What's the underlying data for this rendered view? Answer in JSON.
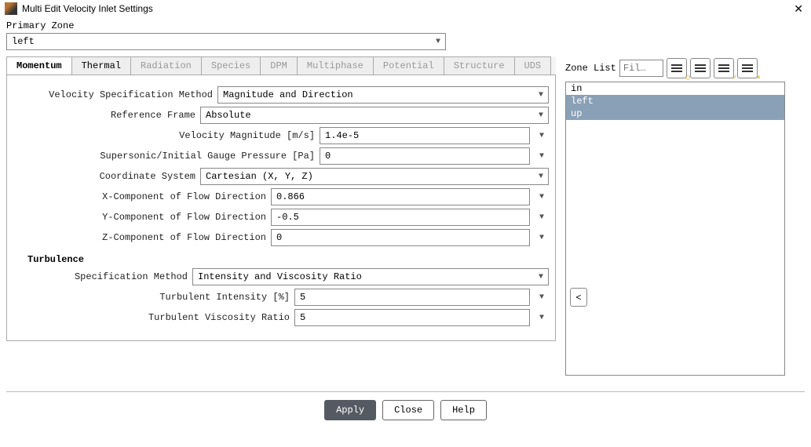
{
  "window": {
    "title": "Multi Edit Velocity Inlet Settings"
  },
  "primary_zone": {
    "label": "Primary Zone",
    "value": "left"
  },
  "tabs": [
    {
      "label": "Momentum",
      "active": true,
      "enabled": true
    },
    {
      "label": "Thermal",
      "active": false,
      "enabled": true
    },
    {
      "label": "Radiation",
      "active": false,
      "enabled": false
    },
    {
      "label": "Species",
      "active": false,
      "enabled": false
    },
    {
      "label": "DPM",
      "active": false,
      "enabled": false
    },
    {
      "label": "Multiphase",
      "active": false,
      "enabled": false
    },
    {
      "label": "Potential",
      "active": false,
      "enabled": false
    },
    {
      "label": "Structure",
      "active": false,
      "enabled": false
    },
    {
      "label": "UDS",
      "active": false,
      "enabled": false
    }
  ],
  "momentum": {
    "velocity_spec_method": {
      "label": "Velocity Specification Method",
      "value": "Magnitude and Direction"
    },
    "reference_frame": {
      "label": "Reference Frame",
      "value": "Absolute"
    },
    "velocity_magnitude": {
      "label": "Velocity Magnitude [m/s]",
      "value": "1.4e-5"
    },
    "supersonic_pressure": {
      "label": "Supersonic/Initial Gauge Pressure [Pa]",
      "value": "0"
    },
    "coord_system": {
      "label": "Coordinate System",
      "value": "Cartesian (X, Y, Z)"
    },
    "x_component": {
      "label": "X-Component of Flow Direction",
      "value": "0.866"
    },
    "y_component": {
      "label": "Y-Component of Flow Direction",
      "value": "-0.5"
    },
    "z_component": {
      "label": "Z-Component of Flow Direction",
      "value": "0"
    },
    "turbulence_header": "Turbulence",
    "turb_spec_method": {
      "label": "Specification Method",
      "value": "Intensity and Viscosity Ratio"
    },
    "turb_intensity": {
      "label": "Turbulent Intensity [%]",
      "value": "5"
    },
    "turb_viscosity_ratio": {
      "label": "Turbulent Viscosity Ratio",
      "value": "5"
    }
  },
  "zone_list": {
    "label": "Zone List",
    "filter_placeholder": "Fil…",
    "items": [
      {
        "name": "in",
        "selected": false
      },
      {
        "name": "left",
        "selected": true
      },
      {
        "name": "up",
        "selected": true
      }
    ]
  },
  "footer": {
    "apply": "Apply",
    "close": "Close",
    "help": "Help"
  }
}
